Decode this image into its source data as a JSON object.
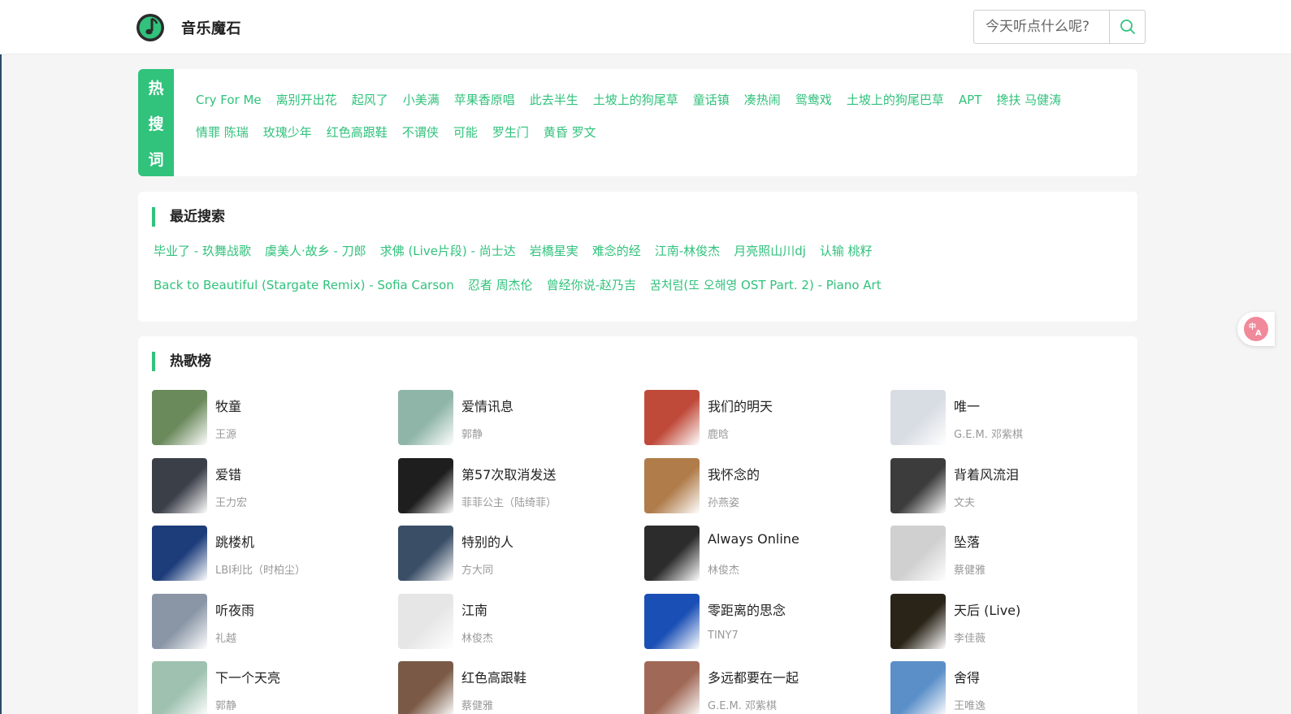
{
  "header": {
    "app_title": "音乐魔石",
    "search_placeholder": "今天听点什么呢?"
  },
  "hot_search": {
    "label_chars": [
      "热",
      "搜",
      "词"
    ],
    "items": [
      "Cry For Me",
      "离别开出花",
      "起风了",
      "小美满",
      "苹果香原唱",
      "此去半生",
      "土坡上的狗尾草",
      "童话镇",
      "凑热闹",
      "鸳鸯戏",
      "土坡上的狗尾巴草",
      "APT",
      "搀扶 马健涛",
      "情罪 陈瑞",
      "玫瑰少年",
      "红色高跟鞋",
      "不谓侠",
      "可能",
      "罗生门",
      "黄昏 罗文"
    ]
  },
  "recent_search": {
    "title": "最近搜索",
    "items": [
      "毕业了 - 玖舞战歌",
      "虞美人·故乡 - 刀郎",
      "求佛 (Live片段) - 尚士达",
      "岩橋星実",
      "难念的经",
      "江南-林俊杰",
      "月亮照山川dj",
      "认输 桃籽",
      "Back to Beautiful (Stargate Remix) - Sofia Carson",
      "忍者 周杰伦",
      "曾经你说-赵乃吉",
      "꿈처럼(또 오해영 OST Part. 2) - Piano Art"
    ]
  },
  "hot_chart": {
    "title": "热歌榜",
    "songs": [
      {
        "name": "牧童",
        "artist": "王源",
        "color": "#6b8a5c"
      },
      {
        "name": "爱情讯息",
        "artist": "郭静",
        "color": "#8fb5a8"
      },
      {
        "name": "我们的明天",
        "artist": "鹿晗",
        "color": "#c04a3a"
      },
      {
        "name": "唯一",
        "artist": "G.E.M. 邓紫棋",
        "color": "#d8dde4"
      },
      {
        "name": "爱错",
        "artist": "王力宏",
        "color": "#3a3f48"
      },
      {
        "name": "第57次取消发送",
        "artist": "菲菲公主（陆绮菲）",
        "color": "#1e1e1e"
      },
      {
        "name": "我怀念的",
        "artist": "孙燕姿",
        "color": "#b07c4a"
      },
      {
        "name": "背着风流泪",
        "artist": "文夫",
        "color": "#3c3c3c"
      },
      {
        "name": "跳楼机",
        "artist": "LBI利比（时柏尘）",
        "color": "#1c3c7a"
      },
      {
        "name": "特别的人",
        "artist": "方大同",
        "color": "#3a4e66"
      },
      {
        "name": "Always Online",
        "artist": "林俊杰",
        "color": "#2c2c2c"
      },
      {
        "name": "坠落",
        "artist": "蔡健雅",
        "color": "#d0d0d0"
      },
      {
        "name": "听夜雨",
        "artist": "礼越",
        "color": "#8a96a6"
      },
      {
        "name": "江南",
        "artist": "林俊杰",
        "color": "#e6e6e6"
      },
      {
        "name": "零距离的思念",
        "artist": "TINY7",
        "color": "#1a4fb5"
      },
      {
        "name": "天后 (Live)",
        "artist": "李佳薇",
        "color": "#2a2418"
      },
      {
        "name": "下一个天亮",
        "artist": "郭静",
        "color": "#9fc2b0"
      },
      {
        "name": "红色高跟鞋",
        "artist": "蔡健雅",
        "color": "#7a5a46"
      },
      {
        "name": "多远都要在一起",
        "artist": "G.E.M. 邓紫棋",
        "color": "#a06856"
      },
      {
        "name": "舍得",
        "artist": "王唯逸",
        "color": "#5a8fc8"
      }
    ]
  },
  "colors": {
    "accent": "#31c27c"
  },
  "icons": {
    "logo": "music-note-logo-icon",
    "search": "search-icon",
    "translate": "translate-icon"
  }
}
